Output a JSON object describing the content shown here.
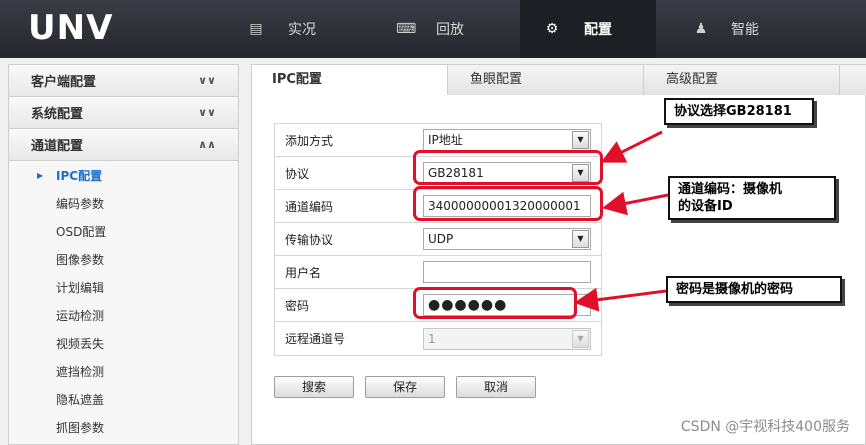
{
  "app": {
    "logo": "UNV"
  },
  "nav": [
    {
      "label": "实况",
      "icon": "monitor-icon"
    },
    {
      "label": "回放",
      "icon": "keyboard-icon"
    },
    {
      "label": "配置",
      "icon": "gear-icon",
      "active": true
    },
    {
      "label": "智能",
      "icon": "person-search-icon"
    }
  ],
  "sidebar": {
    "sections": [
      {
        "label": "客户端配置",
        "state": "collapsed"
      },
      {
        "label": "系统配置",
        "state": "collapsed"
      },
      {
        "label": "通道配置",
        "state": "expanded"
      }
    ],
    "items": [
      "IPC配置",
      "编码参数",
      "OSD配置",
      "图像参数",
      "计划编辑",
      "运动检测",
      "视频丢失",
      "遮挡检测",
      "隐私遮盖",
      "抓图参数"
    ],
    "active_index": 0
  },
  "tabs": [
    "IPC配置",
    "鱼眼配置",
    "高级配置"
  ],
  "form": {
    "add_method": {
      "label": "添加方式",
      "value": "IP地址"
    },
    "protocol": {
      "label": "协议",
      "value": "GB28181"
    },
    "channel_code": {
      "label": "通道编码",
      "value": "34000000001320000001"
    },
    "transport": {
      "label": "传输协议",
      "value": "UDP"
    },
    "username": {
      "label": "用户名",
      "value": ""
    },
    "password": {
      "label": "密码",
      "value": "●●●●●●"
    },
    "remote_channel": {
      "label": "远程通道号",
      "value": "1"
    }
  },
  "buttons": {
    "search": "搜索",
    "save": "保存",
    "cancel": "取消"
  },
  "annotations": {
    "protocol_note": "协议选择GB28181",
    "channel_note_line1": "通道编码：摄像机",
    "channel_note_line2": "的设备ID",
    "password_note": "密码是摄像机的密码"
  },
  "watermark": "CSDN @宇视科技400服务",
  "colors": {
    "accent": "#1a6fd0",
    "highlight": "#e0102a",
    "topbar": "#2b2d33"
  }
}
